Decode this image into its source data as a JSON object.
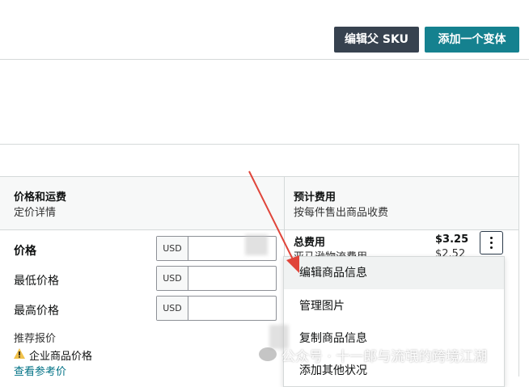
{
  "toolbar": {
    "edit_parent_sku": "编辑父 SKU",
    "add_variant": "添加一个变体"
  },
  "section": {
    "price_header": {
      "title": "价格和运费",
      "subtitle": "定价详情"
    },
    "fee_header": {
      "title": "预计费用",
      "subtitle": "按每件售出商品收费"
    },
    "rows": [
      {
        "label": "价格",
        "currency": "USD",
        "value": ""
      },
      {
        "label": "最低价格",
        "currency": "USD",
        "value": ""
      },
      {
        "label": "最高价格",
        "currency": "USD",
        "value": ""
      }
    ],
    "recommended": {
      "title": "推荐报价",
      "business_price": "企业商品价格",
      "view_reference": "查看参考价"
    },
    "fees": {
      "total_label": "总费用",
      "total_value": "$3.25",
      "sub_label": "亚马逊物流费用",
      "sub_value": "$2.52"
    }
  },
  "menu": {
    "items": [
      "编辑商品信息",
      "管理图片",
      "复制商品信息",
      "添加其他状况"
    ]
  },
  "watermark": "公众号 · 十一郎与流氓的跨境江湖",
  "colors": {
    "accent_teal": "#15818f",
    "dark_button": "#37424f",
    "arrow_red": "#e0453a",
    "warning": "#f0c14b"
  }
}
